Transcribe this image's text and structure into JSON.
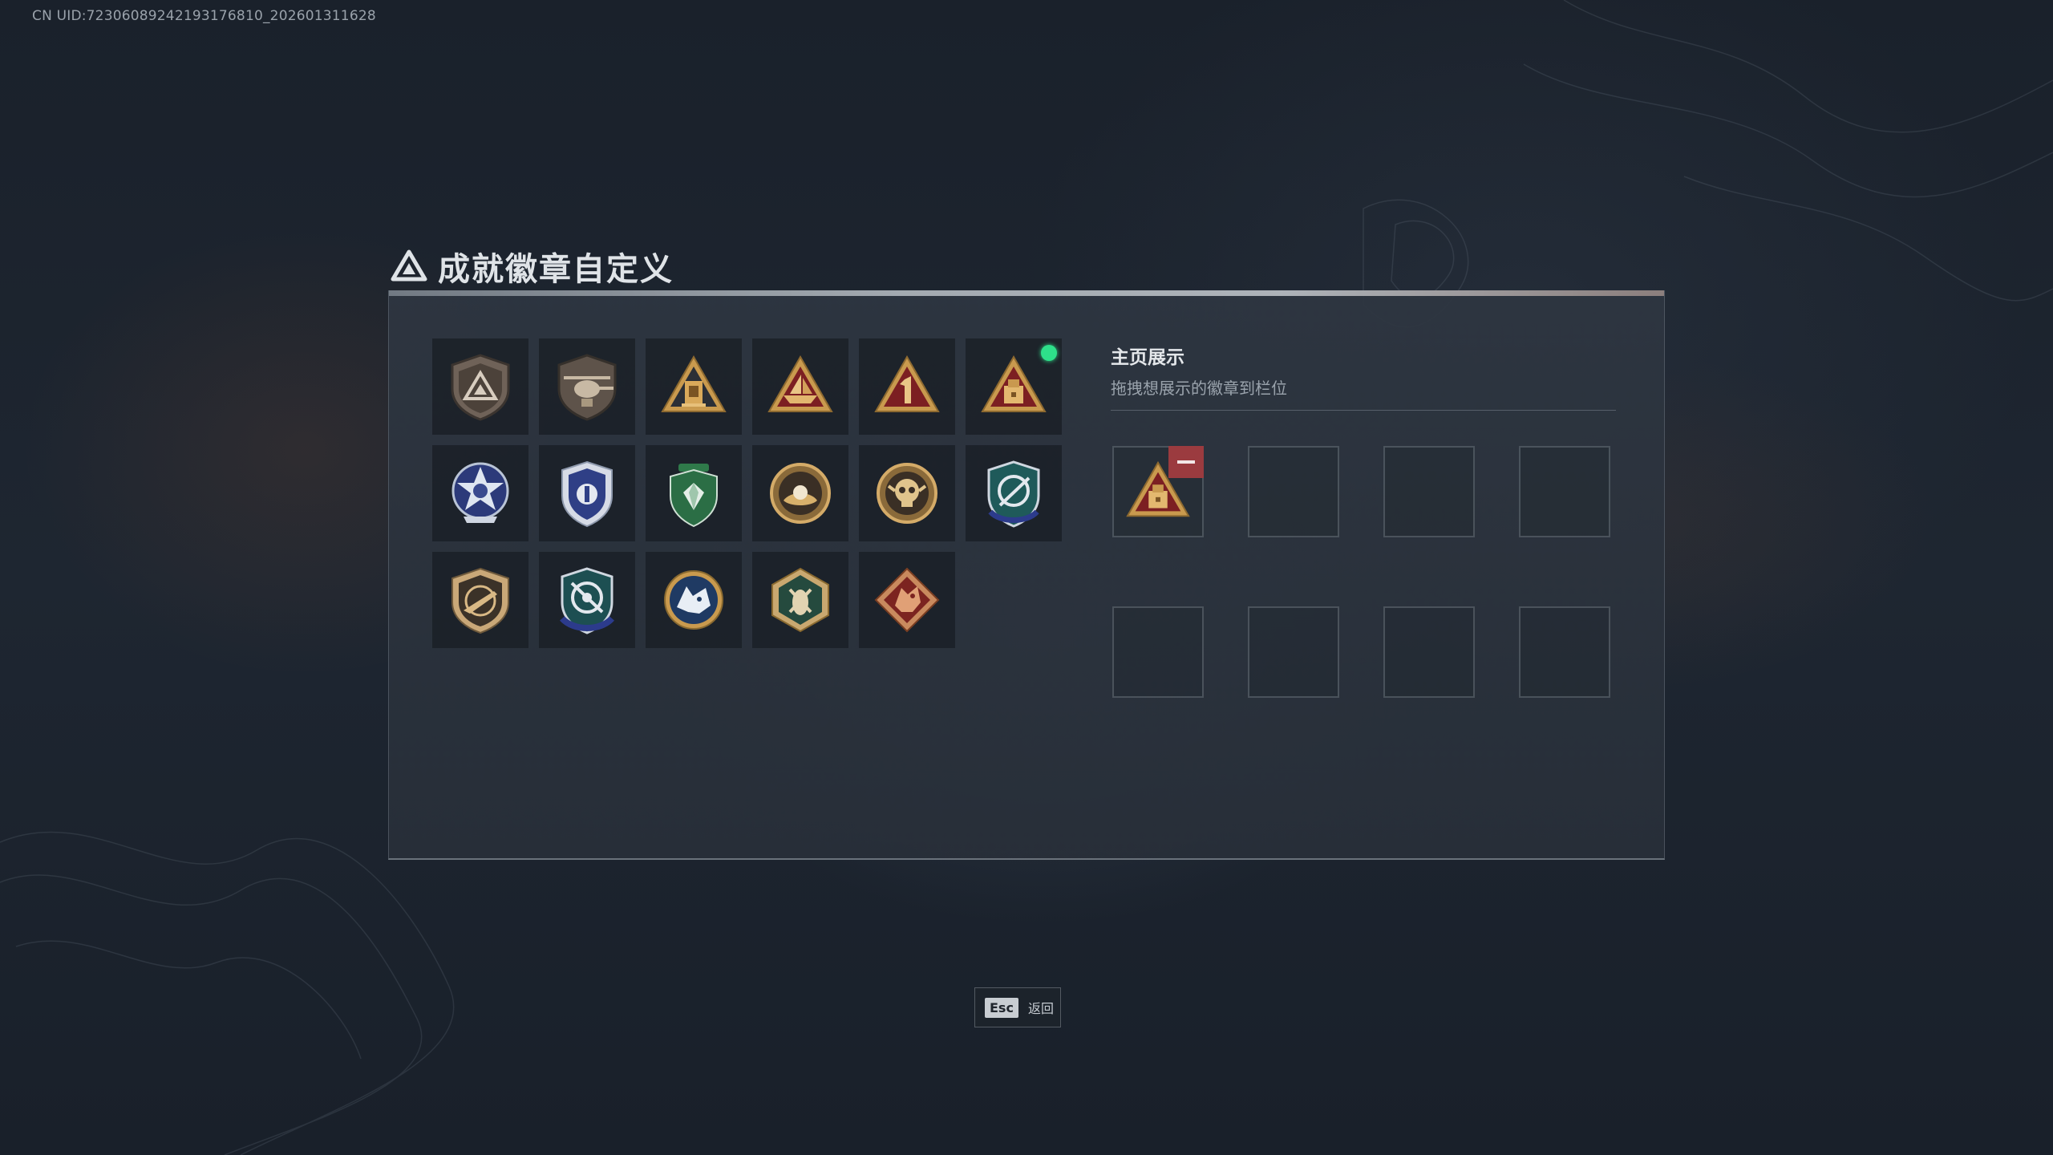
{
  "uid_text": "CN UID:7230608924219317681​0_202601311628",
  "header": {
    "title": "成就徽章自定义",
    "icon": "triangle-logo-icon"
  },
  "badges": [
    {
      "name": "triangle-shield-badge"
    },
    {
      "name": "helicopter-shield-badge"
    },
    {
      "name": "gold-tower-triangle-badge"
    },
    {
      "name": "ship-triangle-badge"
    },
    {
      "name": "number-one-triangle-badge"
    },
    {
      "name": "chest-triangle-badge",
      "new": true
    },
    {
      "name": "blue-star-medal-badge"
    },
    {
      "name": "blue-crest-badge"
    },
    {
      "name": "green-gem-crest-badge"
    },
    {
      "name": "pearl-round-badge"
    },
    {
      "name": "skull-round-badge"
    },
    {
      "name": "blue-target-crest-badge"
    },
    {
      "name": "rifle-shield-badge"
    },
    {
      "name": "blue-target-medal-badge"
    },
    {
      "name": "wolf-round-badge"
    },
    {
      "name": "insect-hexagon-badge"
    },
    {
      "name": "dragon-diamond-badge"
    }
  ],
  "display": {
    "title": "主页展示",
    "subtitle": "拖拽想展示的徽章到栏位",
    "slots": [
      {
        "badge": "chest-triangle-badge"
      },
      {
        "badge": null
      },
      {
        "badge": null
      },
      {
        "badge": null
      },
      {
        "badge": null
      },
      {
        "badge": null
      },
      {
        "badge": null
      },
      {
        "badge": null
      }
    ]
  },
  "footer": {
    "key": "Esc",
    "label": "返回"
  },
  "colors": {
    "accent_new": "#2ee08a",
    "remove": "#9b3b3f",
    "gold": "#c99a4e",
    "crimson": "#7c1f22"
  }
}
